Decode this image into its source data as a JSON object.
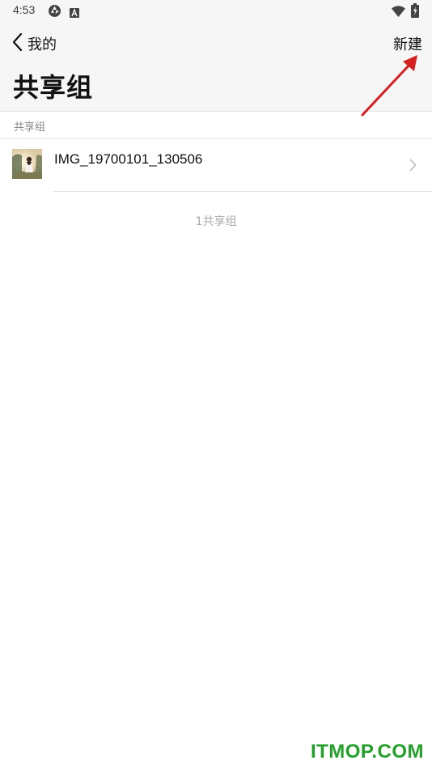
{
  "status_bar": {
    "time": "4:53",
    "icons": [
      "aperture-icon",
      "font-a-icon",
      "wifi-icon",
      "battery-charging-icon"
    ]
  },
  "header": {
    "back_label": "我的",
    "new_label": "新建",
    "title": "共享组"
  },
  "section": {
    "label": "共享组"
  },
  "groups": [
    {
      "name": "IMG_19700101_130506",
      "thumbnail": "photo-thumbnail"
    }
  ],
  "footer": {
    "count_text": "1共享组"
  },
  "watermark": {
    "text": "ITMOP.COM"
  },
  "colors": {
    "header_bg": "#f6f6f6",
    "divider": "#e2e2e2",
    "secondary_text": "#8a8a8a",
    "annotation_arrow": "#d61f1f",
    "watermark": "#22a02a"
  }
}
